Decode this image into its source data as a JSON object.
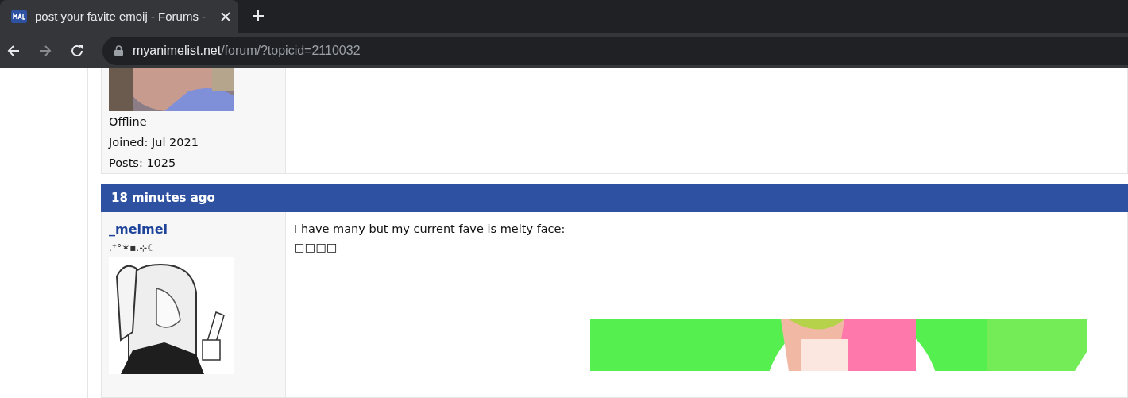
{
  "browser": {
    "tab_title": "post your favite emoij - Forums -",
    "tab_selected": true,
    "url_host": "myanimelist.net",
    "url_path": "/forum/?topicid=2110032"
  },
  "posts": [
    {
      "user": {
        "status": "Offline",
        "joined": "Joined: Jul 2021",
        "posts": "Posts: 1025"
      }
    },
    {
      "header": "18 minutes ago",
      "user": {
        "name": "_meimei",
        "decoration": ".⁺°✶▪.⊹☾"
      },
      "message": [
        "I have many but my current fave is melty face:",
        "□□□□"
      ]
    }
  ]
}
